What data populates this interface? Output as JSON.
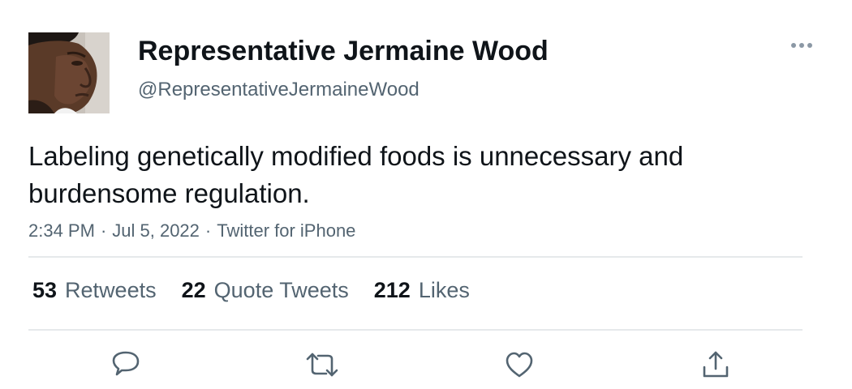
{
  "tweet": {
    "author": {
      "display_name": "Representative Jermaine Wood",
      "handle": "@RepresentativeJermaineWood"
    },
    "text": "Labeling genetically modified foods is unnecessary and burdensome regulation.",
    "time": "2:34 PM",
    "date": "Jul 5, 2022",
    "source": "Twitter for iPhone",
    "separator": "·"
  },
  "stats": {
    "retweets": {
      "count": "53",
      "label": "Retweets"
    },
    "quote_tweets": {
      "count": "22",
      "label": "Quote Tweets"
    },
    "likes": {
      "count": "212",
      "label": "Likes"
    }
  },
  "actions": [
    {
      "icon": "reply-icon"
    },
    {
      "icon": "retweet-icon"
    },
    {
      "icon": "like-icon"
    },
    {
      "icon": "share-icon"
    }
  ],
  "colors": {
    "text_primary": "#0f1419",
    "text_secondary": "#536471",
    "divider": "#e6e9eb"
  }
}
